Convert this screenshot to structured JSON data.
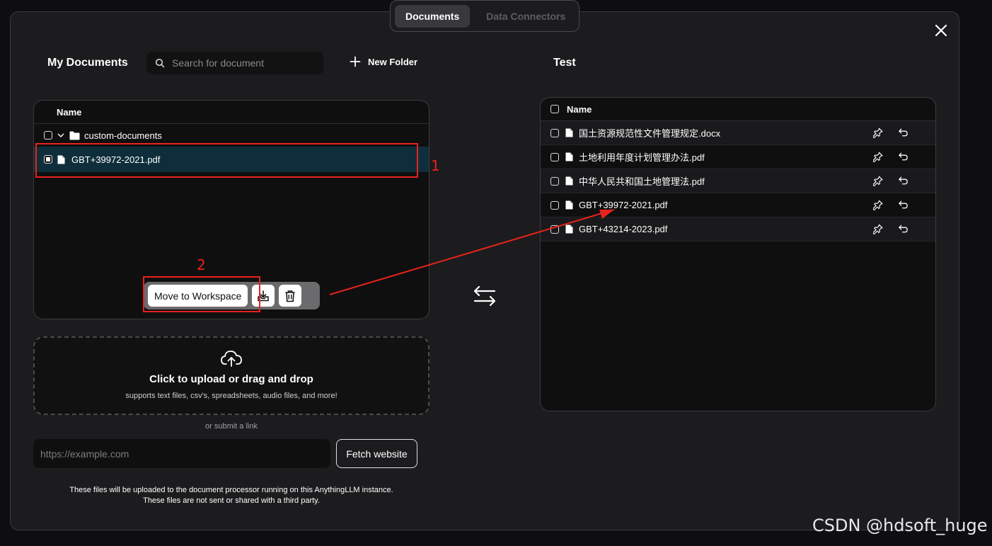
{
  "tabs": [
    {
      "label": "Documents",
      "active": true
    },
    {
      "label": "Data Connectors",
      "active": false
    }
  ],
  "left": {
    "title": "My Documents",
    "search_placeholder": "Search for document",
    "new_folder_label": "New Folder",
    "column_name": "Name",
    "folder": {
      "name": "custom-documents"
    },
    "files": [
      {
        "name": "GBT+39972-2021.pdf",
        "selected": true
      }
    ],
    "actions": {
      "move_label": "Move to Workspace",
      "save_icon": "tray-download-icon",
      "delete_icon": "trash-icon"
    }
  },
  "upload": {
    "title": "Click to upload or drag and drop",
    "subtitle": "supports text files, csv's, spreadsheets, audio files, and more!",
    "or_link": "or submit a link",
    "url_placeholder": "https://example.com",
    "fetch_label": "Fetch website",
    "note_line1": "These files will be uploaded to the document processor running on this AnythingLLM instance.",
    "note_line2": "These files are not sent or shared with a third party."
  },
  "workspace": {
    "title": "Test",
    "column_name": "Name",
    "files": [
      {
        "name": "国土资源规范性文件管理规定.docx"
      },
      {
        "name": "土地利用年度计划管理办法.pdf"
      },
      {
        "name": "中华人民共和国土地管理法.pdf"
      },
      {
        "name": "GBT+39972-2021.pdf"
      },
      {
        "name": "GBT+43214-2023.pdf"
      }
    ]
  },
  "annotations": {
    "label1": "1",
    "label2": "2",
    "color": "#e8221d"
  },
  "watermark": "CSDN @hdsoft_huge",
  "colors": {
    "background": "#1c1c1e",
    "selected_row": "#0f2e3b",
    "panel": "#0f0f10"
  }
}
